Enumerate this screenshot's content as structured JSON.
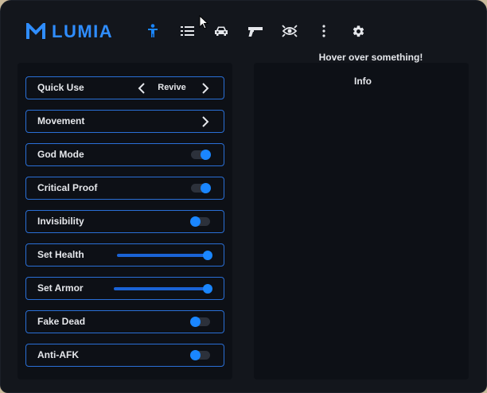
{
  "brand": {
    "name": "LUMIA",
    "color": "#2f8dff"
  },
  "nav": [
    {
      "name": "player-icon",
      "active": true
    },
    {
      "name": "list-icon",
      "active": false
    },
    {
      "name": "car-icon",
      "active": false
    },
    {
      "name": "gun-icon",
      "active": false
    },
    {
      "name": "eye-icon",
      "active": false
    },
    {
      "name": "more-icon",
      "active": false
    },
    {
      "name": "gear-icon",
      "active": false
    }
  ],
  "hover_hint": "Hover over something!",
  "info_panel": {
    "title": "Info"
  },
  "rows": {
    "quick_use": {
      "label": "Quick Use",
      "value": "Revive"
    },
    "movement": {
      "label": "Movement"
    },
    "god_mode": {
      "label": "God Mode",
      "enabled": true
    },
    "critical_proof": {
      "label": "Critical Proof",
      "enabled": true
    },
    "invisibility": {
      "label": "Invisibility",
      "enabled": false
    },
    "set_health": {
      "label": "Set Health",
      "level": 1.0
    },
    "set_armor": {
      "label": "Set Armor",
      "level": 1.0
    },
    "fake_dead": {
      "label": "Fake Dead",
      "enabled": false
    },
    "anti_afk": {
      "label": "Anti-AFK",
      "enabled": false
    }
  },
  "colors": {
    "accent": "#1a86ff",
    "border": "#2a6fd6",
    "panel": "#0d1016",
    "window": "#13161c",
    "text": "#e5e7eb",
    "icon": "#e5e7eb"
  }
}
